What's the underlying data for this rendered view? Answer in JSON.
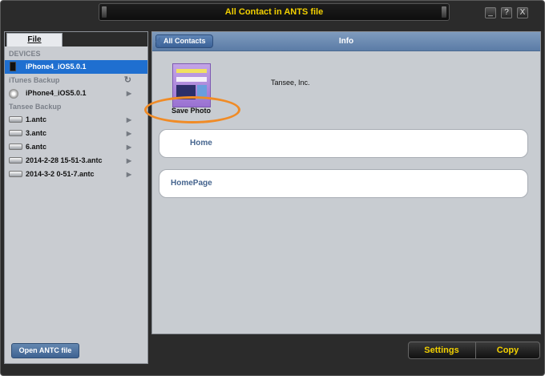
{
  "window": {
    "title": "All Contact in ANTS file",
    "controls": [
      "_",
      "?",
      "X"
    ]
  },
  "sidebar": {
    "file_tab": "File",
    "sections": [
      {
        "header": "DEVICES",
        "items": [
          {
            "label": "iPhone4_iOS5.0.1",
            "icon": "iphone-icon",
            "selected": true
          }
        ]
      },
      {
        "header": "iTunes Backup",
        "items": [
          {
            "label": "iPhone4_iOS5.0.1",
            "icon": "itunes-icon"
          }
        ]
      },
      {
        "header": "Tansee Backup",
        "items": [
          {
            "label": "1.antc",
            "icon": "disk-icon"
          },
          {
            "label": "3.antc",
            "icon": "disk-icon"
          },
          {
            "label": "6.antc",
            "icon": "disk-icon"
          },
          {
            "label": "2014-2-28 15-51-3.antc",
            "icon": "disk-icon"
          },
          {
            "label": "2014-3-2 0-51-7.antc",
            "icon": "disk-icon"
          }
        ]
      }
    ],
    "open_button": "Open ANTC file"
  },
  "main": {
    "back_button": "All Contacts",
    "title": "Info",
    "save_photo": "Save Photo",
    "company": "Tansee, Inc.",
    "fields": [
      {
        "label": "Home"
      },
      {
        "label": "HomePage"
      }
    ]
  },
  "footer": {
    "settings": "Settings",
    "copy": "Copy"
  },
  "colors": {
    "accent_yellow": "#f2d000",
    "highlight_orange": "#f08b26",
    "selection_blue": "#1f6fd0"
  }
}
